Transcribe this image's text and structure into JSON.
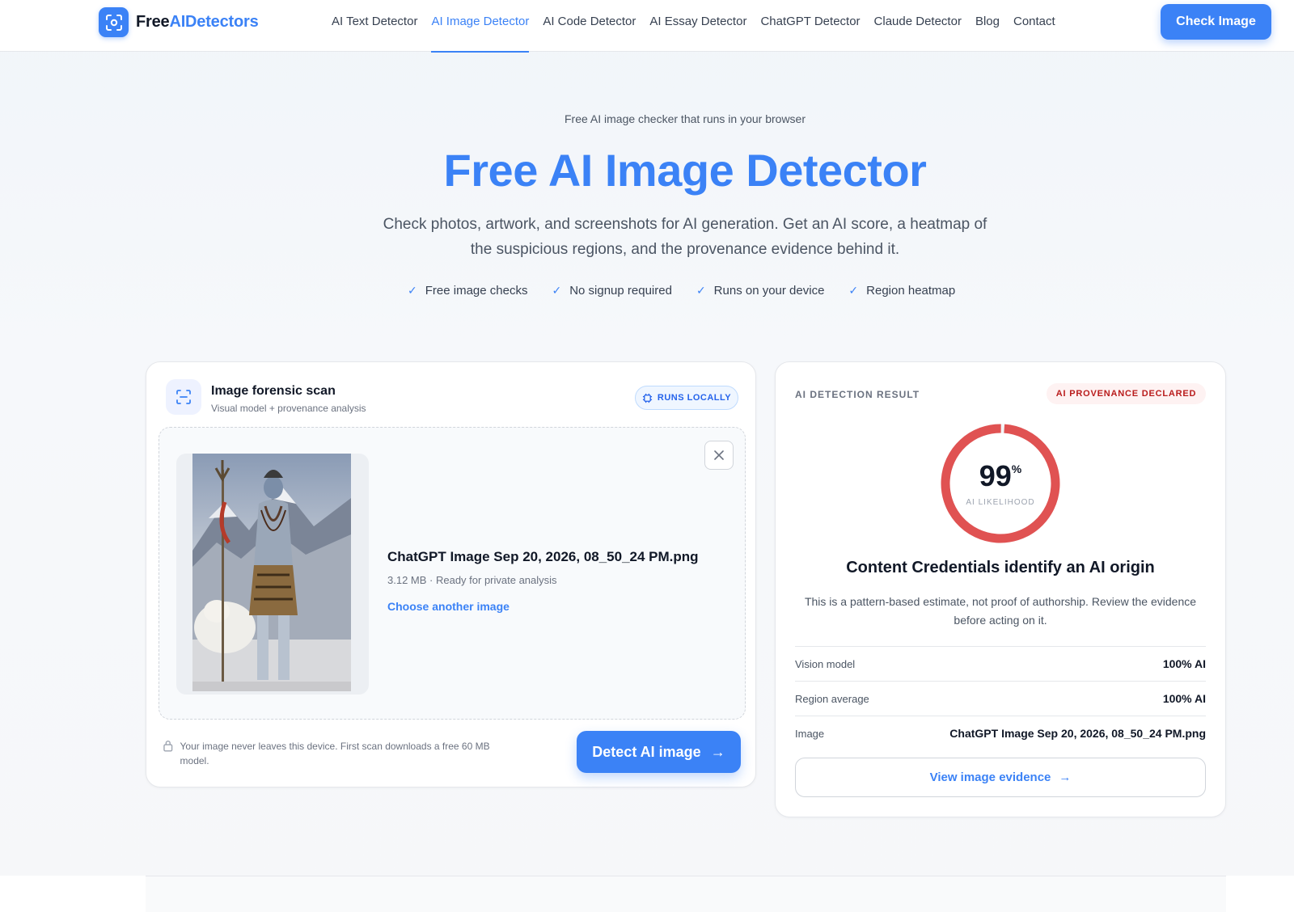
{
  "brand": {
    "name_part1": "Free",
    "name_part2": "AIDetectors",
    "accent": "#3b82f6"
  },
  "nav": {
    "items": [
      {
        "label": "AI Text Detector",
        "active": false
      },
      {
        "label": "AI Image Detector",
        "active": true
      },
      {
        "label": "AI Code Detector",
        "active": false
      },
      {
        "label": "AI Essay Detector",
        "active": false
      },
      {
        "label": "ChatGPT Detector",
        "active": false
      },
      {
        "label": "Claude Detector",
        "active": false
      },
      {
        "label": "Blog",
        "active": false
      },
      {
        "label": "Contact",
        "active": false
      }
    ],
    "cta_label": "Check Image"
  },
  "hero": {
    "eyebrow": "Free AI image checker that runs in your browser",
    "title": "Free AI Image Detector",
    "subtitle": "Check photos, artwork, and screenshots for AI generation. Get an AI score, a heatmap of the suspicious regions, and the provenance evidence behind it.",
    "features": [
      "Free image checks",
      "No signup required",
      "Runs on your device",
      "Region heatmap"
    ]
  },
  "scan": {
    "title": "Image forensic scan",
    "subtitle": "Visual model + provenance analysis",
    "badge": "RUNS LOCALLY",
    "file_name": "ChatGPT Image Sep 20, 2026, 08_50_24 PM.png",
    "file_meta": "3.12 MB · Ready for private analysis",
    "choose_label": "Choose another image",
    "privacy_note": "Your image never leaves this device. First scan downloads a free 60 MB model.",
    "detect_label": "Detect AI image"
  },
  "result": {
    "label": "AI DETECTION RESULT",
    "badge": "AI PROVENANCE DECLARED",
    "score": "99",
    "score_unit": "%",
    "score_fraction": 0.99,
    "score_caption": "AI LIKELIHOOD",
    "headline": "Content Credentials identify an AI origin",
    "note": "This is a pattern-based estimate, not proof of authorship. Review the evidence before acting on it.",
    "rows": [
      {
        "key": "Vision model",
        "value": "100% AI"
      },
      {
        "key": "Region average",
        "value": "100% AI"
      },
      {
        "key": "Image",
        "value": "ChatGPT Image Sep 20, 2026, 08_50_24 PM.png"
      }
    ],
    "evidence_label": "View image evidence",
    "gauge_color": "#e05252"
  }
}
